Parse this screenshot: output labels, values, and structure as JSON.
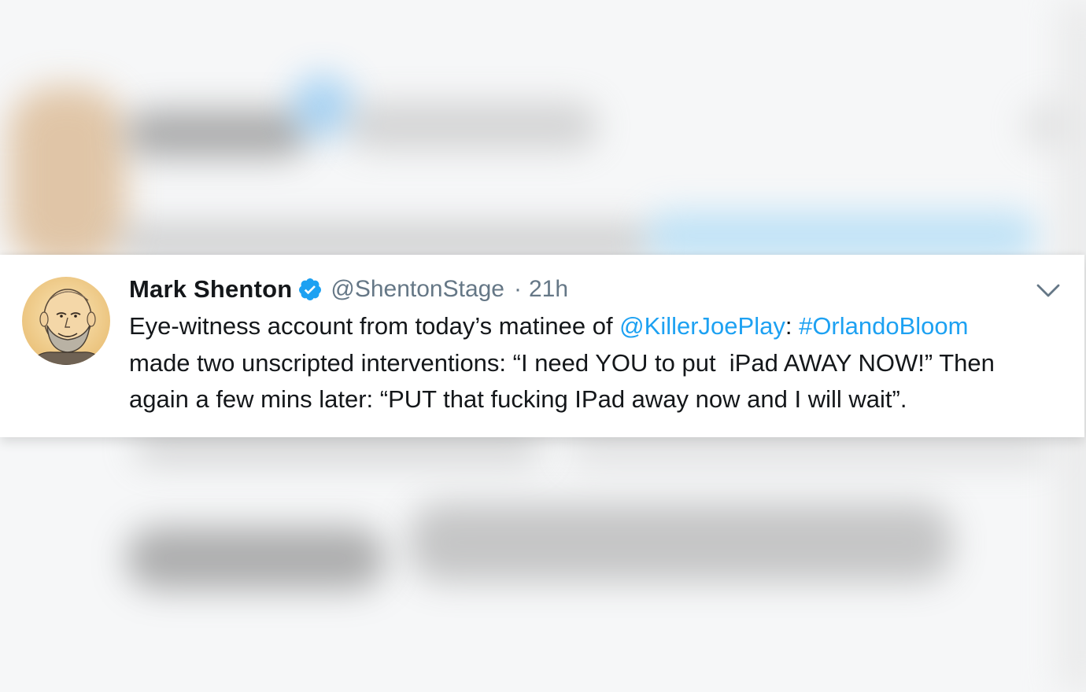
{
  "tweet": {
    "display_name": "Mark Shenton",
    "handle": "@ShentonStage",
    "separator": "·",
    "timestamp": "21h",
    "verified_icon": "verified-badge-icon",
    "menu_icon": "chevron-down-icon",
    "avatar_icon": "profile-avatar-illustration",
    "body": {
      "line1_a": "Eye-witness account from today’s matinee of ",
      "mention": "@KillerJoePlay",
      "line1_b": ": ",
      "hashtag": "#OrlandoBloom",
      "line2": "made two unscripted interventions: “I need YOU to put  iPad AWAY NOW!” Then",
      "line3": "again a few mins later: “PUT that fucking IPad away now and I will wait”."
    }
  },
  "colors": {
    "link": "#1da1f2",
    "text": "#14171a",
    "meta": "#657786",
    "verified": "#1da1f2",
    "avatar_bg": "#f2d39a"
  }
}
